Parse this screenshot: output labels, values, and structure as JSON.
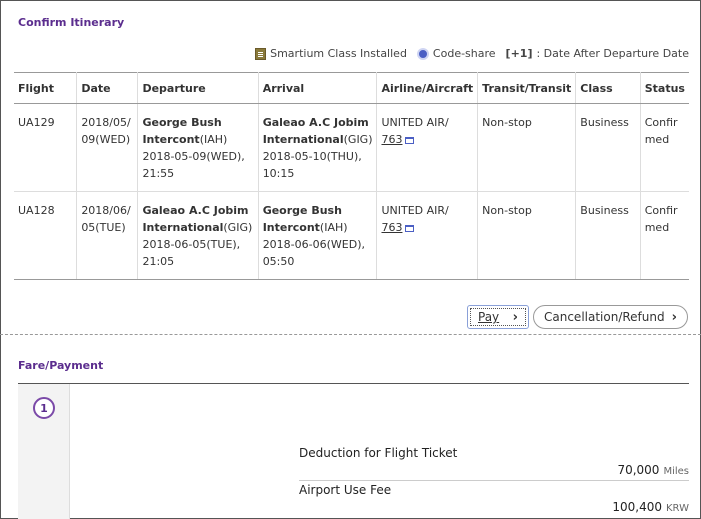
{
  "itinerary": {
    "title": "Confirm Itinerary",
    "legend": {
      "smartium": "Smartium Class Installed",
      "codeshare": "Code-share",
      "plus1_tag": "[+1]",
      "plus1_text": " : Date After Departure Date"
    },
    "columns": [
      "Flight",
      "Date",
      "Departure",
      "Arrival",
      "Airline/Aircraft",
      "Transit/Transit",
      "Class",
      "Status"
    ],
    "rows": [
      {
        "flight": "UA129",
        "date": "2018/05/09(WED)",
        "dep_airport": "George Bush Intercont",
        "dep_code": "(IAH)",
        "dep_time": "2018-05-09(WED), 21:55",
        "arr_airport": "Galeao A.C Jobim International",
        "arr_code": "(GIG)",
        "arr_time": "2018-05-10(THU), 10:15",
        "airline": "UNITED AIR/",
        "aircraft": "763",
        "transit": "Non-stop",
        "class": "Business",
        "status": "Confirmed"
      },
      {
        "flight": "UA128",
        "date": "2018/06/05(TUE)",
        "dep_airport": "Galeao A.C Jobim International",
        "dep_code": "(GIG)",
        "dep_time": "2018-06-05(TUE), 21:05",
        "arr_airport": "George Bush Intercont",
        "arr_code": "(IAH)",
        "arr_time": "2018-06-06(WED), 05:50",
        "airline": "UNITED AIR/",
        "aircraft": "763",
        "transit": "Non-stop",
        "class": "Business",
        "status": "Confirmed"
      }
    ]
  },
  "actions": {
    "pay": "Pay",
    "cancel": "Cancellation/Refund"
  },
  "fare": {
    "title": "Fare/Payment",
    "step": "1",
    "items": [
      {
        "label": "Deduction for Flight Ticket",
        "value": "70,000",
        "unit": "Miles"
      },
      {
        "label": "Airport Use Fee",
        "value": "100,400",
        "unit": "KRW"
      }
    ]
  },
  "colors": {
    "accent": "#5b2d8e",
    "codeshare": "#4b5fc4"
  }
}
